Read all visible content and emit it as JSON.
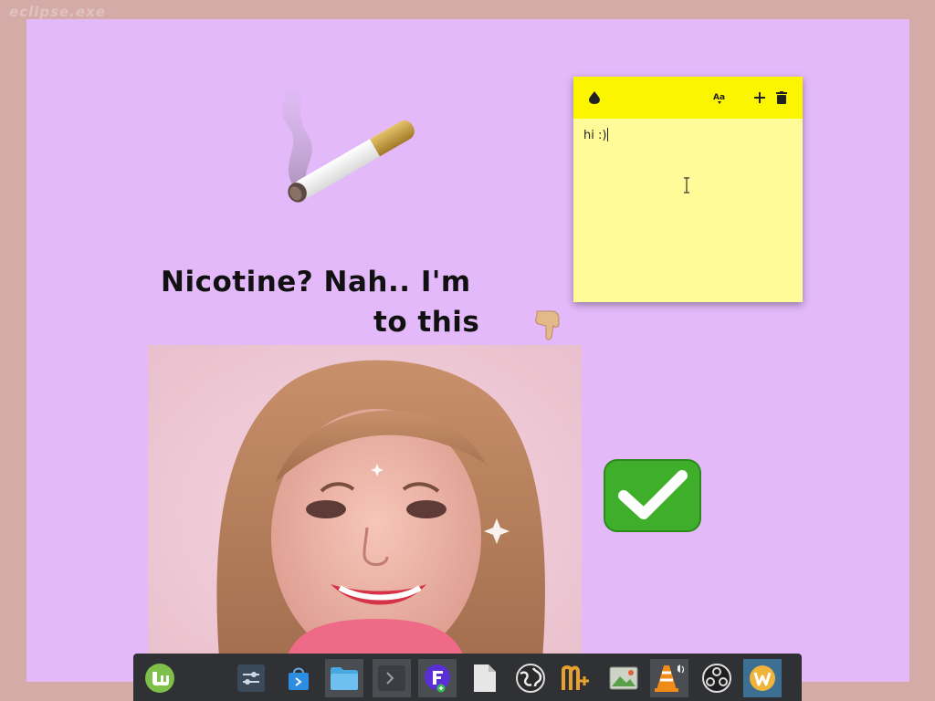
{
  "watermark": "eclipse.exe",
  "meme": {
    "line1": "Nicotine? Nah.. I'm",
    "line2": "to this"
  },
  "sticky_note": {
    "text": "hi :)",
    "icons": [
      "color-drop-icon",
      "font-size-icon",
      "add-note-icon",
      "delete-note-icon"
    ]
  },
  "taskbar": {
    "items": [
      {
        "name": "linux-mint-menu",
        "icon": "mint-logo-icon"
      },
      {
        "name": "system-settings",
        "icon": "sliders-icon"
      },
      {
        "name": "software-manager",
        "icon": "shopping-bag-icon"
      },
      {
        "name": "file-manager",
        "icon": "folder-icon"
      },
      {
        "name": "terminal",
        "icon": "terminal-icon"
      },
      {
        "name": "app-f",
        "icon": "f-logo-icon"
      },
      {
        "name": "text-editor",
        "icon": "document-icon"
      },
      {
        "name": "web-browser",
        "icon": "globe-icon"
      },
      {
        "name": "notes-app",
        "icon": "n-plus-icon"
      },
      {
        "name": "image-viewer",
        "icon": "picture-icon"
      },
      {
        "name": "vlc-media-player",
        "icon": "traffic-cone-icon"
      },
      {
        "name": "obs-studio",
        "icon": "obs-icon"
      },
      {
        "name": "app-w",
        "icon": "w-logo-icon"
      }
    ]
  },
  "colors": {
    "outer_background": "#d4aba7",
    "wallpaper": "#e3b9fa",
    "sticky_header": "#fbf600",
    "sticky_body": "#fffb99",
    "taskbar": "#2f3135"
  }
}
